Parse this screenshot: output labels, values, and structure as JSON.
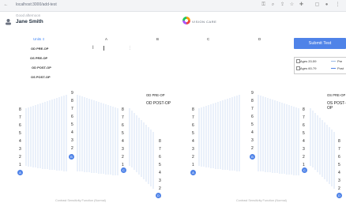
{
  "browser": {
    "url": "localhost:3000/add-test"
  },
  "header": {
    "subtitle": "Good afternoon",
    "user_name": "Jane Smith",
    "logo_text": "VISION CARE"
  },
  "table": {
    "headers": [
      "Units",
      "A",
      "B",
      "C",
      "D"
    ],
    "eye_indicator": "⇕",
    "rows": [
      "OD PRE-OP",
      "OS PRE-OP",
      "OD POST-OP",
      "OS POST-OP"
    ]
  },
  "submit_label": "Submit Test",
  "legend": {
    "items": [
      "Ages 20-59",
      "Ages 60-79"
    ],
    "series": [
      "Pre",
      "Post"
    ]
  },
  "charts": [
    {
      "left_scale": [
        "8",
        "7",
        "6",
        "5",
        "4",
        "3",
        "2",
        "1"
      ],
      "left_badge": "A",
      "mid_scale": [
        "9",
        "8",
        "7",
        "6",
        "5",
        "4",
        "3",
        "2",
        "1"
      ],
      "mid_badge": "B",
      "right_scale": [
        "8",
        "7",
        "6",
        "5",
        "4",
        "3",
        "2",
        "1"
      ],
      "right_badge": "C",
      "far_scale": [
        "8",
        "7",
        "6",
        "5",
        "4",
        "3",
        "2",
        "1"
      ],
      "far_badge": "D",
      "titles": [
        "OD PRE-OP",
        "OD POST-OP"
      ],
      "caption": "Contrast Sensitivity Function (Normal)"
    },
    {
      "left_scale": [
        "8",
        "7",
        "6",
        "5",
        "4",
        "3",
        "2",
        "1"
      ],
      "left_badge": "A",
      "mid_scale": [
        "9",
        "8",
        "7",
        "6",
        "5",
        "4",
        "3",
        "2",
        "1"
      ],
      "mid_badge": "B",
      "right_scale": [
        "8",
        "7",
        "6",
        "5",
        "4",
        "3",
        "2",
        "1"
      ],
      "right_badge": "C",
      "far_scale": [
        "8",
        "7",
        "6",
        "5",
        "4",
        "3",
        "2",
        "1"
      ],
      "far_badge": "D",
      "titles": [
        "OS PRE-OP",
        "OS POST-OP"
      ],
      "caption": "Contrast Sensitivity Function (Normal)"
    }
  ]
}
